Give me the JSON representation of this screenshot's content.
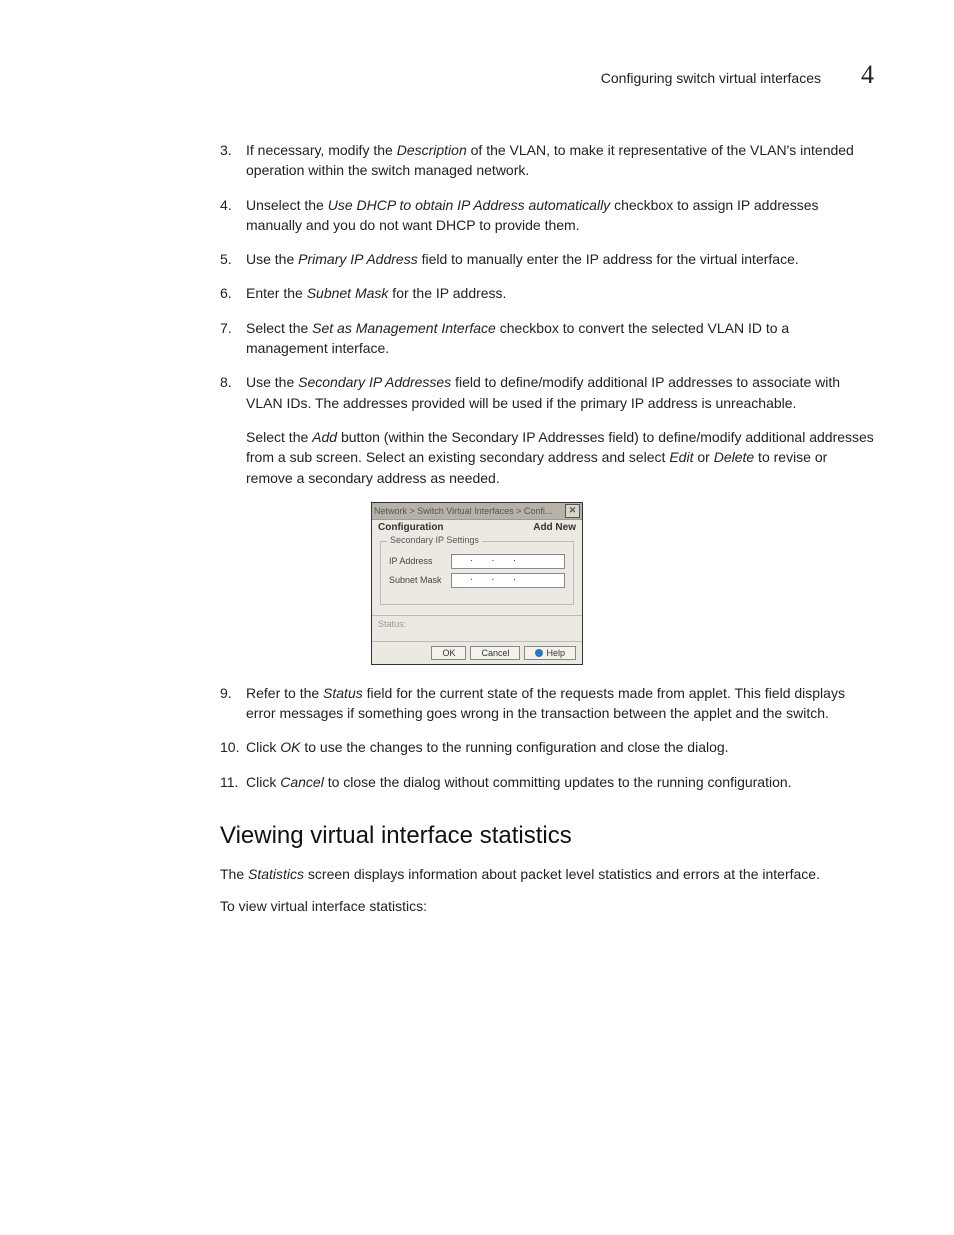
{
  "header": {
    "title": "Configuring switch virtual interfaces",
    "chapter": "4"
  },
  "steps": {
    "s3": {
      "num": "3.",
      "prefix": "If necessary, modify the ",
      "em1": "Description",
      "rest": " of the VLAN, to make it representative of the VLAN's intended operation within the switch managed network."
    },
    "s4": {
      "num": "4.",
      "prefix": "Unselect the ",
      "em1": "Use DHCP to obtain IP Address automatically",
      "rest": " checkbox to assign IP addresses manually and you do not want DHCP to provide them."
    },
    "s5": {
      "num": "5.",
      "prefix": "Use the ",
      "em1": "Primary IP Address",
      "rest": " field to manually enter the IP address for the virtual interface."
    },
    "s6": {
      "num": "6.",
      "prefix": "Enter the ",
      "em1": "Subnet Mask",
      "rest": " for the IP address."
    },
    "s7": {
      "num": "7.",
      "prefix": "Select the ",
      "em1": "Set as Management Interface",
      "rest": " checkbox to convert the selected VLAN ID to a management interface."
    },
    "s8": {
      "num": "8.",
      "prefix": "Use the ",
      "em1": "Secondary IP Addresses",
      "rest": " field to define/modify additional IP addresses to associate with VLAN IDs. The addresses provided will be used if the primary IP address is unreachable."
    },
    "s8b": {
      "prefix": "Select the ",
      "em1": "Add",
      "mid": " button (within the Secondary IP Addresses field) to define/modify additional addresses from a sub screen. Select an existing secondary address and select ",
      "em2": "Edit",
      "mid2": " or ",
      "em3": "Delete",
      "rest": " to revise or remove a secondary address as needed."
    },
    "s9": {
      "num": "9.",
      "prefix": "Refer to the ",
      "em1": "Status",
      "rest": " field for the current state of the requests made from applet. This field displays error messages if something goes wrong in the transaction between the applet and the switch."
    },
    "s10": {
      "num": "10.",
      "prefix": "Click ",
      "em1": "OK",
      "rest": " to use the changes to the running configuration and close the dialog."
    },
    "s11": {
      "num": "11.",
      "prefix": "Click ",
      "em1": "Cancel",
      "rest": " to close the dialog without committing updates to the running configuration."
    }
  },
  "dialog": {
    "breadcrumb": "Network > Switch Virtual Interfaces > Confi...",
    "tab": "Configuration",
    "addnew": "Add New",
    "legend": "Secondary IP Settings",
    "ip_label": "IP Address",
    "mask_label": "Subnet Mask",
    "status_label": "Status:",
    "ok": "OK",
    "cancel": "Cancel",
    "help": "Help"
  },
  "section": {
    "heading": "Viewing virtual interface statistics",
    "p1_a": "The ",
    "p1_em": "Statistics",
    "p1_b": " screen displays information about packet level statistics and errors at the interface.",
    "p2": "To view virtual interface statistics:"
  }
}
